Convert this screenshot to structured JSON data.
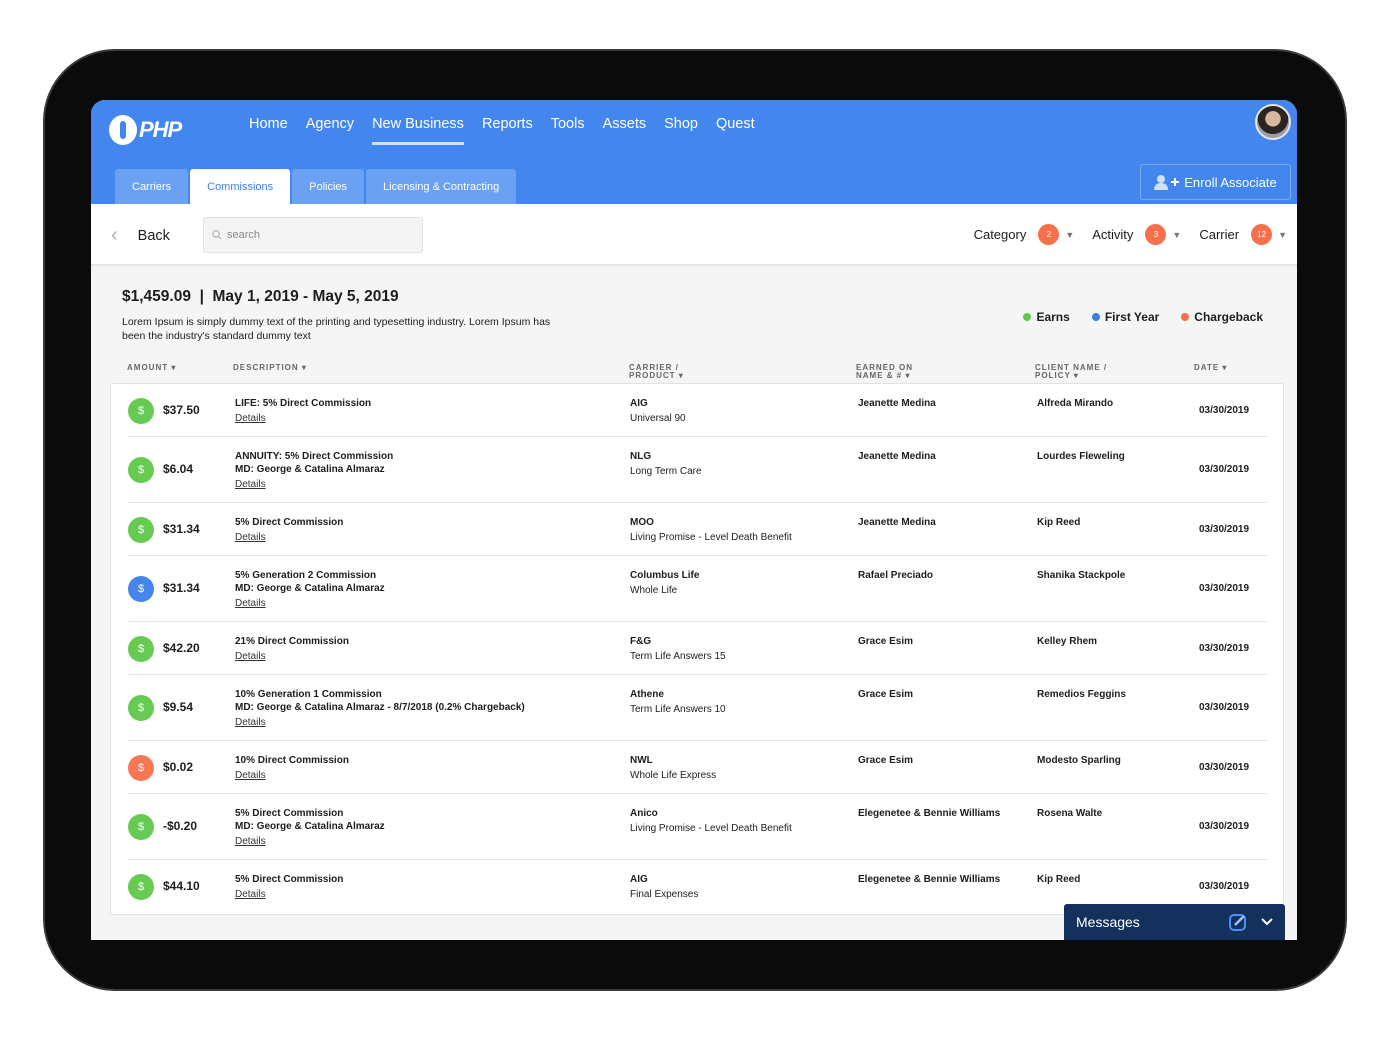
{
  "header": {
    "logo": "PHP",
    "nav": [
      "Home",
      "Agency",
      "New Business",
      "Reports",
      "Tools",
      "Assets",
      "Shop",
      "Quest"
    ],
    "active_nav": "New Business",
    "tabs": [
      "Carriers",
      "Commissions",
      "Policies",
      "Licensing & Contracting"
    ],
    "active_tab": "Commissions",
    "enroll_label": "Enroll Associate"
  },
  "toolbar": {
    "back_label": "Back",
    "search_placeholder": "search",
    "filters": [
      {
        "label": "Category",
        "count": "2"
      },
      {
        "label": "Activity",
        "count": "3"
      },
      {
        "label": "Carrier",
        "count": "12"
      }
    ]
  },
  "summary": {
    "title": "$1,459.09  |  May 1, 2019 - May 5, 2019",
    "text": "Lorem Ipsum is simply dummy text of the printing and typesetting industry. Lorem Ipsum has been the industry's standard dummy text"
  },
  "legend": [
    {
      "label": "Earns",
      "color": "#5ec84a"
    },
    {
      "label": "First Year",
      "color": "#3d7fea"
    },
    {
      "label": "Chargeback",
      "color": "#f7704b"
    }
  ],
  "columns": {
    "amount": "AMOUNT",
    "description": "DESCRIPTION",
    "carrier": "CARRIER / PRODUCT",
    "earned": "EARNED ON NAME & #",
    "client": "CLIENT NAME / POLICY",
    "date": "DATE"
  },
  "details_label": "Details",
  "rows": [
    {
      "type": "earns",
      "amount": "$37.50",
      "desc": [
        "LIFE: 5% Direct Commission"
      ],
      "carrier": "AIG",
      "product": "Universal 90",
      "earned": "Jeanette Medina",
      "client": "Alfreda Mirando",
      "date": "03/30/2019"
    },
    {
      "type": "earns",
      "amount": "$6.04",
      "desc": [
        "ANNUITY: 5% Direct Commission",
        "MD: George & Catalina Almaraz"
      ],
      "carrier": "NLG",
      "product": "Long Term Care",
      "earned": "Jeanette Medina",
      "client": "Lourdes Fleweling",
      "date": "03/30/2019"
    },
    {
      "type": "earns",
      "amount": "$31.34",
      "desc": [
        "5% Direct Commission"
      ],
      "carrier": "MOO",
      "product": "Living Promise - Level Death Benefit",
      "earned": "Jeanette Medina",
      "client": "Kip Reed",
      "date": "03/30/2019"
    },
    {
      "type": "first_year",
      "amount": "$31.34",
      "desc": [
        "5% Generation 2 Commission",
        "MD: George & Catalina Almaraz"
      ],
      "carrier": "Columbus Life",
      "product": "Whole Life",
      "earned": "Rafael Preciado",
      "client": "Shanika Stackpole",
      "date": "03/30/2019"
    },
    {
      "type": "earns",
      "amount": "$42.20",
      "desc": [
        "21% Direct Commission"
      ],
      "carrier": "F&G",
      "product": "Term Life Answers 15",
      "earned": "Grace Esim",
      "client": "Kelley Rhem",
      "date": "03/30/2019"
    },
    {
      "type": "earns",
      "amount": "$9.54",
      "desc": [
        "10% Generation 1 Commission",
        "MD: George & Catalina Almaraz  - 8/7/2018 (0.2% Chargeback)"
      ],
      "carrier": "Athene",
      "product": "Term Life Answers 10",
      "earned": "Grace Esim",
      "client": "Remedios Feggins",
      "date": "03/30/2019"
    },
    {
      "type": "chargeback",
      "amount": "$0.02",
      "desc": [
        "10% Direct Commission"
      ],
      "carrier": "NWL",
      "product": "Whole Life Express",
      "earned": "Grace Esim",
      "client": "Modesto Sparling",
      "date": "03/30/2019"
    },
    {
      "type": "earns",
      "amount": "-$0.20",
      "desc": [
        "5% Direct Commission",
        "MD: George & Catalina Almaraz"
      ],
      "carrier": "Anico",
      "product": "Living Promise - Level Death Benefit",
      "earned": "Elegenetee & Bennie Williams",
      "client": "Rosena Walte",
      "date": "03/30/2019"
    },
    {
      "type": "earns",
      "amount": "$44.10",
      "desc": [
        "5% Direct Commission"
      ],
      "carrier": "AIG",
      "product": "Final Expenses",
      "earned": "Elegenetee & Bennie Williams",
      "client": "Kip Reed",
      "date": "03/30/2019"
    }
  ],
  "messages": {
    "label": "Messages"
  }
}
